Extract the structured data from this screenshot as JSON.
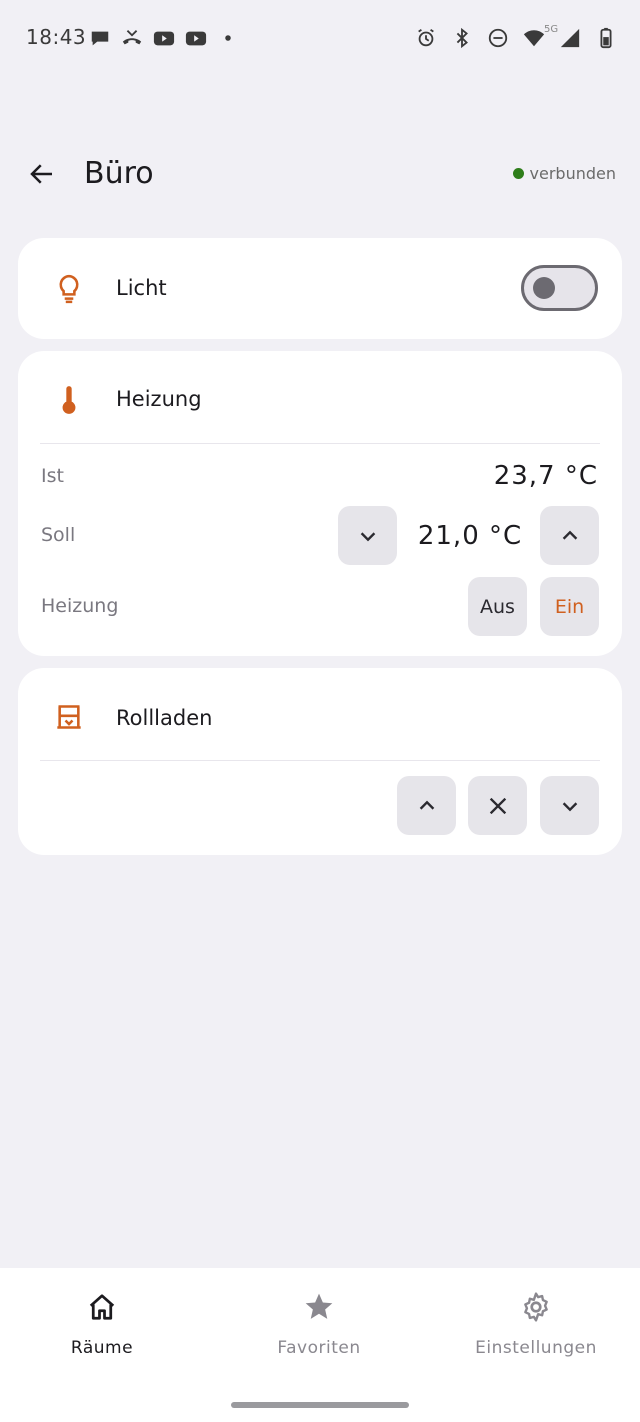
{
  "status_bar": {
    "time": "18:43",
    "left_icons": [
      "chat-icon",
      "missed-call-icon",
      "youtube-icon",
      "youtube-icon",
      "dot-icon"
    ],
    "right_icons": [
      "alarm-icon",
      "bluetooth-icon",
      "dnd-icon",
      "wifi-icon",
      "signal-icon",
      "battery-icon"
    ],
    "network_label": "5G"
  },
  "header": {
    "title": "Büro",
    "connection_status": "verbunden",
    "connection_color": "#2e7d1a"
  },
  "accent_color": "#d0601f",
  "cards": {
    "light": {
      "title": "Licht",
      "icon": "lightbulb-icon",
      "on": false
    },
    "heating": {
      "title": "Heizung",
      "icon": "thermometer-icon",
      "ist_label": "Ist",
      "ist_value": "23,7 °C",
      "soll_label": "Soll",
      "soll_value": "21,0 °C",
      "mode_label": "Heizung",
      "off_label": "Aus",
      "on_label": "Ein"
    },
    "shutter": {
      "title": "Rollladen",
      "icon": "shutter-icon"
    }
  },
  "bottom_nav": {
    "items": [
      {
        "label": "Räume",
        "icon": "home-icon",
        "active": true
      },
      {
        "label": "Favoriten",
        "icon": "star-icon",
        "active": false
      },
      {
        "label": "Einstellungen",
        "icon": "gear-icon",
        "active": false
      }
    ]
  }
}
